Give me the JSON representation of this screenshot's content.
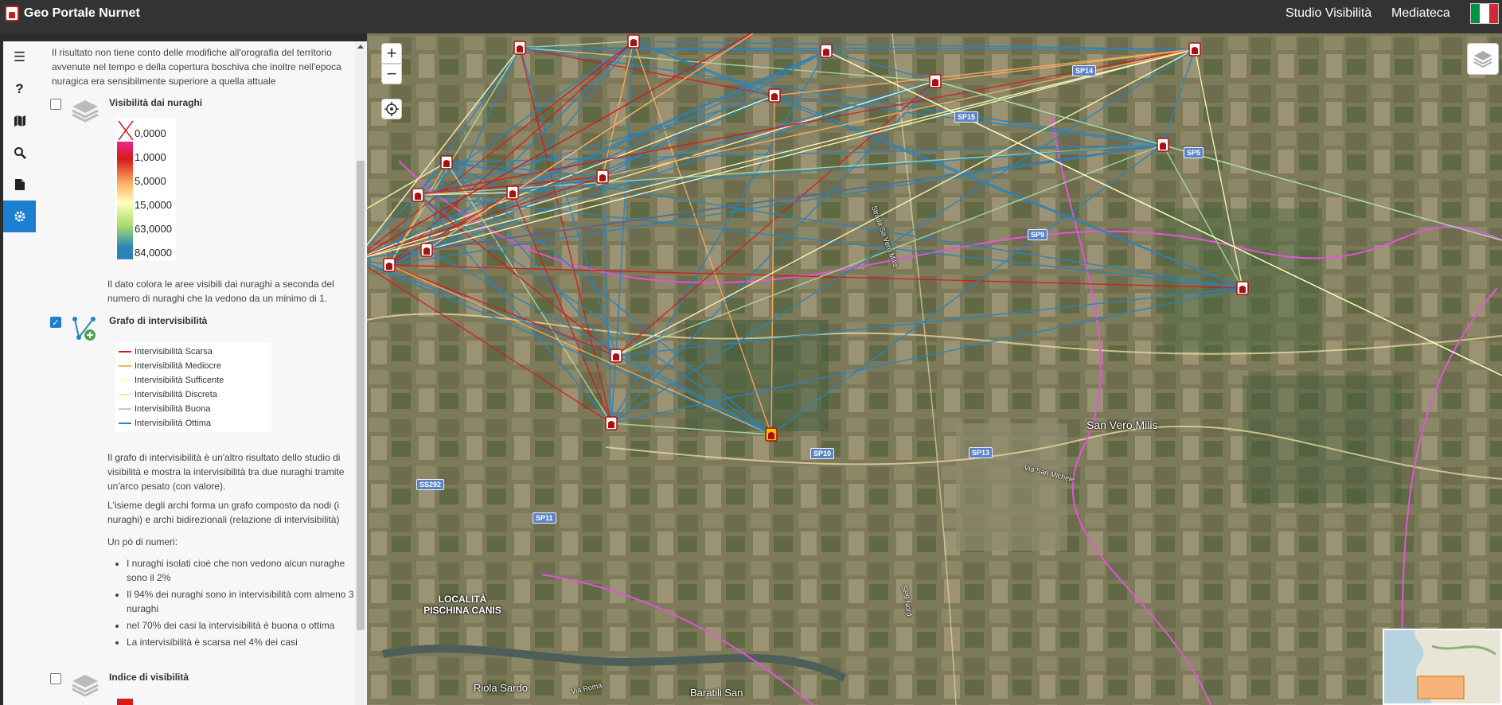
{
  "header": {
    "title": "Geo Portale Nurnet",
    "nav": [
      "Studio Visibilità",
      "Mediateca"
    ],
    "flag_colors": [
      "#009246",
      "#ffffff",
      "#ce2b37"
    ]
  },
  "sidebar_icons": [
    "menu-icon",
    "help-icon",
    "map-icon",
    "search-icon",
    "document-icon",
    "gear-icon"
  ],
  "panel": {
    "intro": "Il risultato non tiene conto delle modifiche all'orografia del territorio avvenute nel tempo e della copertura boschiva che inoltre nell'epoca nuragica era sensibilmente superiore a quella attuale",
    "layer1": {
      "title": "Visibilità dai nuraghi",
      "checked": false,
      "scale": [
        "0,0000",
        "1,0000",
        "5,0000",
        "15,0000",
        "63,0000",
        "84,0000"
      ],
      "description": "Il dato colora le aree visibili dai nuraghi a seconda del numero di nuraghi che la vedono da un minimo di 1."
    },
    "layer2": {
      "title": "Grafo di intervisibilità",
      "checked": true,
      "legend": [
        {
          "label": "Intervisibilità Scarsa",
          "color": "#d7191c"
        },
        {
          "label": "Intervisibilità Mediocre",
          "color": "#fdae61"
        },
        {
          "label": "Intervisibilità Sufficente",
          "color": "#ffffbf"
        },
        {
          "label": "Intervisibilità Discreta",
          "color": "#e6f598"
        },
        {
          "label": "Intervisibilità Buona",
          "color": "#abdda4"
        },
        {
          "label": "Intervisibilità Ottima",
          "color": "#2b83ba"
        }
      ],
      "paragraphs": [
        "Il grafo di intervisibilità è un'altro risultato dello studio di visibilità e mostra la intervisibilità tra due nuraghi tramite un'arco pesato (con valore).",
        "L'isieme degli archi forma un grafo composto da nodi (i nuraghi) e archi bidirezionali (relazione di intervisibilità)",
        "Un pò di numeri:"
      ],
      "stats": [
        "I nuraghi isolati cioè che non vedono alcun nuraghe sono il 2%",
        "Il 94% dei nuraghi sono in intervisibilità com almeno 3 nuraghi",
        "nel 70% dei casi la intervisibilità è buona o ottima",
        "La intervisibilità è scarsa nel 4% dei casi"
      ]
    },
    "layer3": {
      "title": "Indice di visibilità",
      "checked": false
    }
  },
  "map": {
    "zoom_in": "+",
    "zoom_out": "−",
    "places": [
      "San Vero Milis",
      "LOCALITÀ PISCHINA CANIS",
      "Riola Sardo",
      "Baratili San",
      "Via San Michele",
      "Via Roma",
      "Strada Sa Vero Milis",
      "SP9 Nord"
    ],
    "roads": [
      "SP14",
      "SP15",
      "SP5",
      "SP9",
      "SP10",
      "SP13",
      "SS292",
      "SP11"
    ]
  }
}
